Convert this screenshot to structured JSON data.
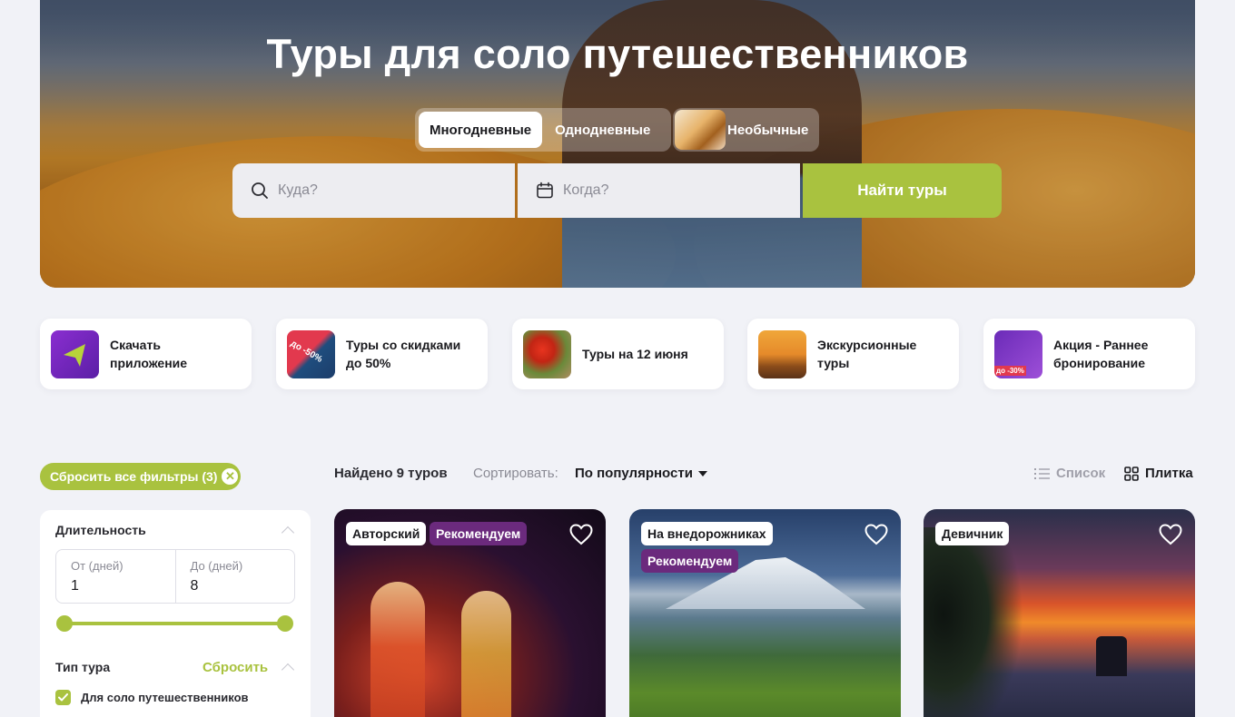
{
  "hero": {
    "title": "Туры для соло путешественников",
    "tabs": [
      "Многодневные",
      "Однодневные"
    ],
    "unusual_tab": "Необычные",
    "search": {
      "where_placeholder": "Куда?",
      "when_placeholder": "Когда?",
      "button": "Найти туры"
    }
  },
  "quick_links": [
    {
      "label": "Скачать приложение",
      "icon": "app-arrow-icon"
    },
    {
      "label": "Туры со скидками до 50%",
      "badge": "до -50%"
    },
    {
      "label": "Туры на 12 июня"
    },
    {
      "label": "Экскурсионные туры"
    },
    {
      "label": "Акция - Раннее бронирование",
      "badge": "до -30%"
    }
  ],
  "filters": {
    "reset_all": "Сбросить все фильтры (3)",
    "duration": {
      "title": "Длительность",
      "from_label": "От (дней)",
      "from_value": "1",
      "to_label": "До (дней)",
      "to_value": "8"
    },
    "tour_type": {
      "title": "Тип тура",
      "reset": "Сбросить",
      "option": "Для соло путешественников",
      "checked": true
    }
  },
  "results": {
    "found": "Найдено 9 туров",
    "sort_label": "Сортировать:",
    "sort_value": "По популярности",
    "view_list": "Список",
    "view_tile": "Плитка"
  },
  "tours": [
    {
      "tags": [
        "Авторский",
        "Рекомендуем"
      ]
    },
    {
      "tags": [
        "На внедорожниках",
        "Рекомендуем"
      ]
    },
    {
      "tags": [
        "Девичник"
      ]
    }
  ],
  "colors": {
    "accent": "#a9c23f",
    "tag_purple": "#6b2a7d",
    "background": "#f1f2f7"
  }
}
